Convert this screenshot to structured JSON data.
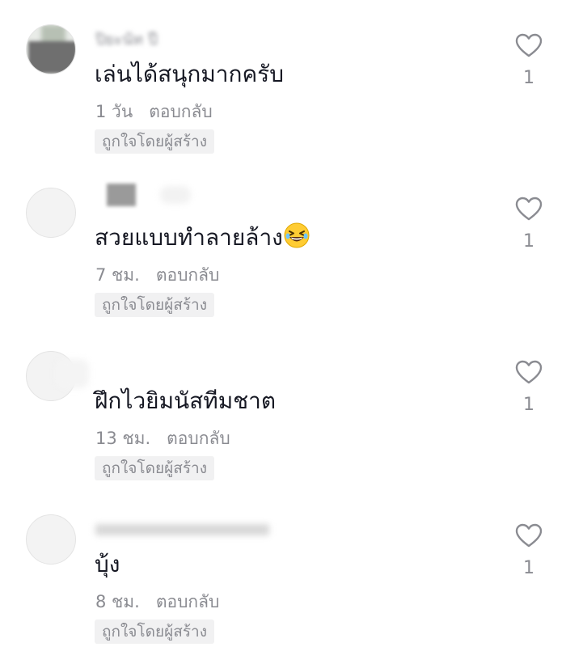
{
  "comments": [
    {
      "username": "ปิยะนัท ปี",
      "text": "เล่นได้สนุกมากครับ",
      "time": "1 วัน",
      "reply_label": "ตอบกลับ",
      "badge": "ถูกใจโดยผู้สร้าง",
      "likes": "1"
    },
    {
      "username": "",
      "text": "สวยแบบทำลายล้าง",
      "time": "7 ชม.",
      "reply_label": "ตอบกลับ",
      "badge": "ถูกใจโดยผู้สร้าง",
      "likes": "1"
    },
    {
      "username": "",
      "text": "ฝึกไวยิมนัสทีมชาต",
      "time": "13 ชม.",
      "reply_label": "ตอบกลับ",
      "badge": "ถูกใจโดยผู้สร้าง",
      "likes": "1"
    },
    {
      "username": "",
      "text": "บุ้ง",
      "time": "8 ชม.",
      "reply_label": "ตอบกลับ",
      "badge": "ถูกใจโดยผู้สร้าง",
      "likes": "1"
    }
  ],
  "icons": {
    "like": "heart-outline-icon",
    "emoji": "grinning-squinting-face-emoji"
  },
  "colors": {
    "text": "#161823",
    "secondary": "#8a8b91",
    "badge_bg": "#f1f1f2",
    "icon": "#8a8b91"
  }
}
